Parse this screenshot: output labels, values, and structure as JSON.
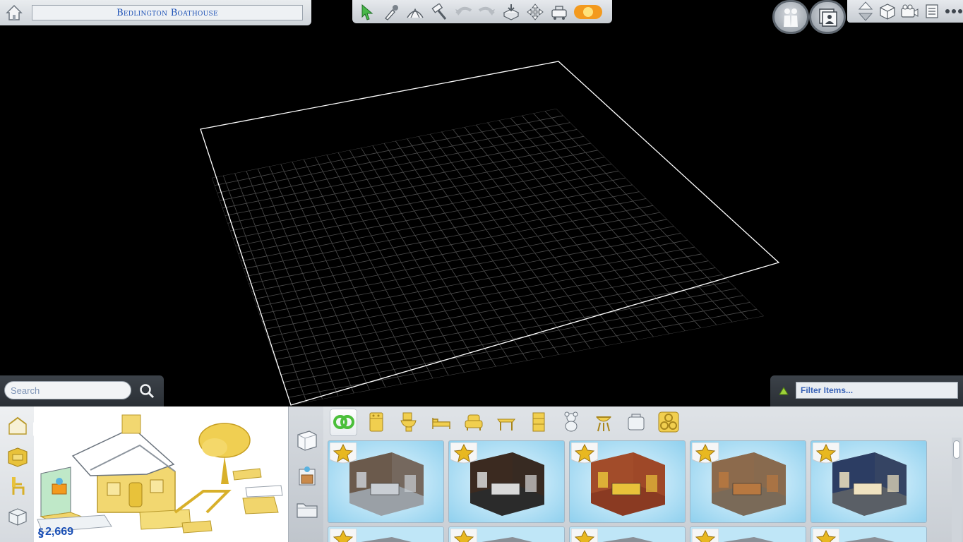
{
  "lot": {
    "name": "Bedlington Boathouse"
  },
  "search": {
    "placeholder": "Search"
  },
  "filter": {
    "placeholder": "Filter Items..."
  },
  "household": {
    "funds": "2,669",
    "currency_symbol": "§"
  },
  "toolbar": {
    "tools": [
      "select-arrow-icon",
      "eyedropper-icon",
      "design-tool-icon",
      "sledgehammer-icon",
      "undo-icon",
      "redo-icon",
      "place-on-lot-icon",
      "move-building-icon",
      "lot-traits-icon",
      "time-of-day-icon"
    ]
  },
  "top_right": {
    "buttons": [
      "manage-households-icon",
      "gallery-icon",
      "floor-up-down-icon",
      "wall-view-icon",
      "camera-icon",
      "list-icon",
      "more-options-icon"
    ]
  },
  "categories": [
    "room-icon",
    "kitchen-icon",
    "bathroom-icon",
    "bedroom-icon",
    "living-room-icon",
    "dining-icon",
    "study-icon",
    "kids-room-icon",
    "outdoor-icon",
    "lot-icon",
    "all-rooms-icon"
  ],
  "tiles_row1": [
    "kitchen-room-1",
    "kitchen-room-2",
    "kitchen-room-3",
    "kitchen-room-4",
    "kitchen-room-5"
  ],
  "colors": {
    "accent_blue": "#1a4fb5",
    "gold": "#e8c23a",
    "panel_gray": "#d6dadf",
    "tile_sky": "#bfe6f7"
  }
}
